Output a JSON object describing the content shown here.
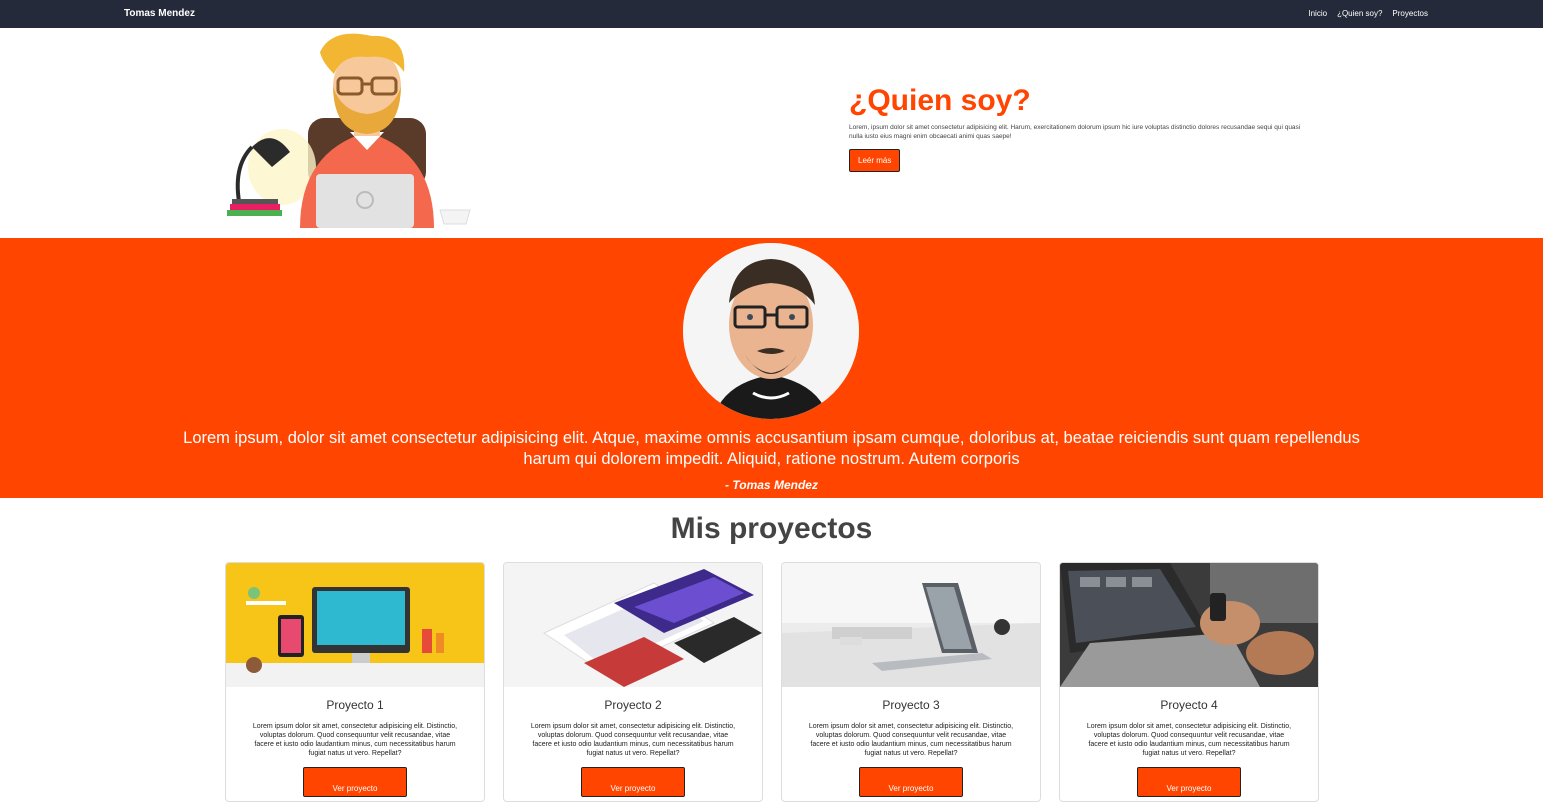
{
  "navbar": {
    "brand": "Tomas Mendez",
    "links": [
      "Inicio",
      "¿Quien soy?",
      "Proyectos"
    ]
  },
  "about": {
    "title": "¿Quien soy?",
    "description": "Lorem, ipsum dolor sit amet consectetur adipisicing elit. Harum, exercitationem dolorum ipsum hic iure voluptas distinctio dolores recusandae sequi qui quasi nulla iusto eius magni enim obcaecati animi quas saepe!",
    "button": "Leér más"
  },
  "quote": {
    "text": "Lorem ipsum, dolor sit amet consectetur adipisicing elit. Atque, maxime omnis accusantium ipsam cumque, doloribus at, beatae reiciendis sunt quam repellendus harum qui dolorem impedit. Aliquid, ratione nostrum. Autem corporis",
    "author": "- Tomas Mendez"
  },
  "projects": {
    "title": "Mis proyectos",
    "items": [
      {
        "title": "Proyecto 1",
        "text": "Lorem ipsum dolor sit amet, consectetur adipisicing elit. Distinctio, voluptas dolorum. Quod consequuntur velit recusandae, vitae facere et iusto odio laudantium minus, cum necessitatibus harum fugiat natus ut vero. Repellat?",
        "button": "Ver proyecto"
      },
      {
        "title": "Proyecto 2",
        "text": "Lorem ipsum dolor sit amet, consectetur adipisicing elit. Distinctio, voluptas dolorum. Quod consequuntur velit recusandae, vitae facere et iusto odio laudantium minus, cum necessitatibus harum fugiat natus ut vero. Repellat?",
        "button": "Ver proyecto"
      },
      {
        "title": "Proyecto 3",
        "text": "Lorem ipsum dolor sit amet, consectetur adipisicing elit. Distinctio, voluptas dolorum. Quod consequuntur velit recusandae, vitae facere et iusto odio laudantium minus, cum necessitatibus harum fugiat natus ut vero. Repellat?",
        "button": "Ver proyecto"
      },
      {
        "title": "Proyecto 4",
        "text": "Lorem ipsum dolor sit amet, consectetur adipisicing elit. Distinctio, voluptas dolorum. Quod consequuntur velit recusandae, vitae facere et iusto odio laudantium minus, cum necessitatibus harum fugiat natus ut vero. Repellat?",
        "button": "Ver proyecto"
      }
    ]
  },
  "colors": {
    "accent": "#ff4500",
    "navbar": "#252a3a"
  }
}
